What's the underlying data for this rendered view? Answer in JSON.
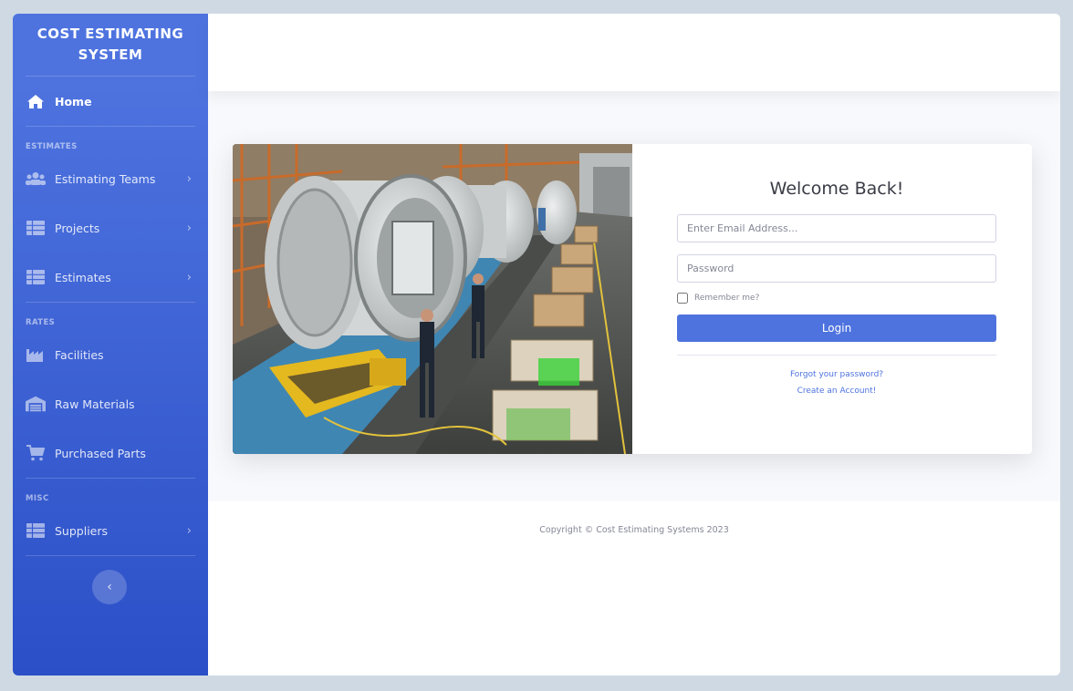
{
  "brand": {
    "line1": "COST ESTIMATING",
    "line2": "SYSTEM"
  },
  "sidebar": {
    "home": {
      "label": "Home",
      "icon": "home-icon"
    },
    "sections": [
      {
        "heading": "ESTIMATES"
      },
      {
        "heading": "RATES"
      },
      {
        "heading": "MISC"
      }
    ],
    "items": {
      "estimating_teams": {
        "label": "Estimating Teams",
        "icon": "users-icon"
      },
      "projects": {
        "label": "Projects",
        "icon": "table-icon"
      },
      "estimates": {
        "label": "Estimates",
        "icon": "table-icon"
      },
      "facilities": {
        "label": "Facilities",
        "icon": "industry-icon"
      },
      "raw_materials": {
        "label": "Raw Materials",
        "icon": "warehouse-icon"
      },
      "purchased_parts": {
        "label": "Purchased Parts",
        "icon": "cart-icon"
      },
      "suppliers": {
        "label": "Suppliers",
        "icon": "table-icon"
      }
    },
    "toggle_glyph": "‹"
  },
  "login": {
    "title": "Welcome Back!",
    "email_placeholder": "Enter Email Address...",
    "password_placeholder": "Password",
    "remember_label": "Remember me?",
    "login_button": "Login",
    "forgot_link": "Forgot your password?",
    "create_link": "Create an Account!"
  },
  "footer": {
    "copyright": "Copyright © Cost Estimating Systems 2023"
  },
  "colors": {
    "primary": "#4e73df",
    "sidebar_end": "#2b4fc7",
    "page_bg": "#f8f9fc",
    "text_dark": "#3a3b45"
  }
}
